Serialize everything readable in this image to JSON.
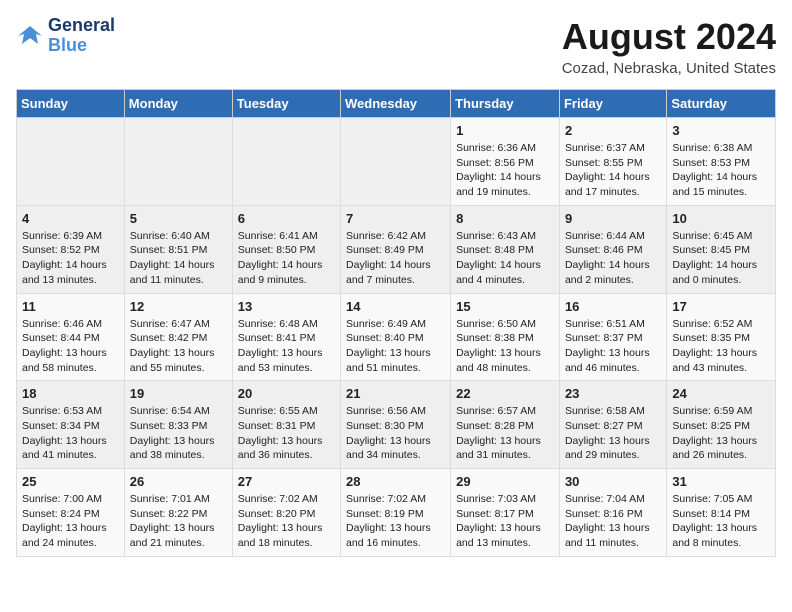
{
  "logo": {
    "line1": "General",
    "line2": "Blue"
  },
  "title": "August 2024",
  "subtitle": "Cozad, Nebraska, United States",
  "days_of_week": [
    "Sunday",
    "Monday",
    "Tuesday",
    "Wednesday",
    "Thursday",
    "Friday",
    "Saturday"
  ],
  "weeks": [
    [
      {
        "day": "",
        "info": ""
      },
      {
        "day": "",
        "info": ""
      },
      {
        "day": "",
        "info": ""
      },
      {
        "day": "",
        "info": ""
      },
      {
        "day": "1",
        "info": "Sunrise: 6:36 AM\nSunset: 8:56 PM\nDaylight: 14 hours\nand 19 minutes."
      },
      {
        "day": "2",
        "info": "Sunrise: 6:37 AM\nSunset: 8:55 PM\nDaylight: 14 hours\nand 17 minutes."
      },
      {
        "day": "3",
        "info": "Sunrise: 6:38 AM\nSunset: 8:53 PM\nDaylight: 14 hours\nand 15 minutes."
      }
    ],
    [
      {
        "day": "4",
        "info": "Sunrise: 6:39 AM\nSunset: 8:52 PM\nDaylight: 14 hours\nand 13 minutes."
      },
      {
        "day": "5",
        "info": "Sunrise: 6:40 AM\nSunset: 8:51 PM\nDaylight: 14 hours\nand 11 minutes."
      },
      {
        "day": "6",
        "info": "Sunrise: 6:41 AM\nSunset: 8:50 PM\nDaylight: 14 hours\nand 9 minutes."
      },
      {
        "day": "7",
        "info": "Sunrise: 6:42 AM\nSunset: 8:49 PM\nDaylight: 14 hours\nand 7 minutes."
      },
      {
        "day": "8",
        "info": "Sunrise: 6:43 AM\nSunset: 8:48 PM\nDaylight: 14 hours\nand 4 minutes."
      },
      {
        "day": "9",
        "info": "Sunrise: 6:44 AM\nSunset: 8:46 PM\nDaylight: 14 hours\nand 2 minutes."
      },
      {
        "day": "10",
        "info": "Sunrise: 6:45 AM\nSunset: 8:45 PM\nDaylight: 14 hours\nand 0 minutes."
      }
    ],
    [
      {
        "day": "11",
        "info": "Sunrise: 6:46 AM\nSunset: 8:44 PM\nDaylight: 13 hours\nand 58 minutes."
      },
      {
        "day": "12",
        "info": "Sunrise: 6:47 AM\nSunset: 8:42 PM\nDaylight: 13 hours\nand 55 minutes."
      },
      {
        "day": "13",
        "info": "Sunrise: 6:48 AM\nSunset: 8:41 PM\nDaylight: 13 hours\nand 53 minutes."
      },
      {
        "day": "14",
        "info": "Sunrise: 6:49 AM\nSunset: 8:40 PM\nDaylight: 13 hours\nand 51 minutes."
      },
      {
        "day": "15",
        "info": "Sunrise: 6:50 AM\nSunset: 8:38 PM\nDaylight: 13 hours\nand 48 minutes."
      },
      {
        "day": "16",
        "info": "Sunrise: 6:51 AM\nSunset: 8:37 PM\nDaylight: 13 hours\nand 46 minutes."
      },
      {
        "day": "17",
        "info": "Sunrise: 6:52 AM\nSunset: 8:35 PM\nDaylight: 13 hours\nand 43 minutes."
      }
    ],
    [
      {
        "day": "18",
        "info": "Sunrise: 6:53 AM\nSunset: 8:34 PM\nDaylight: 13 hours\nand 41 minutes."
      },
      {
        "day": "19",
        "info": "Sunrise: 6:54 AM\nSunset: 8:33 PM\nDaylight: 13 hours\nand 38 minutes."
      },
      {
        "day": "20",
        "info": "Sunrise: 6:55 AM\nSunset: 8:31 PM\nDaylight: 13 hours\nand 36 minutes."
      },
      {
        "day": "21",
        "info": "Sunrise: 6:56 AM\nSunset: 8:30 PM\nDaylight: 13 hours\nand 34 minutes."
      },
      {
        "day": "22",
        "info": "Sunrise: 6:57 AM\nSunset: 8:28 PM\nDaylight: 13 hours\nand 31 minutes."
      },
      {
        "day": "23",
        "info": "Sunrise: 6:58 AM\nSunset: 8:27 PM\nDaylight: 13 hours\nand 29 minutes."
      },
      {
        "day": "24",
        "info": "Sunrise: 6:59 AM\nSunset: 8:25 PM\nDaylight: 13 hours\nand 26 minutes."
      }
    ],
    [
      {
        "day": "25",
        "info": "Sunrise: 7:00 AM\nSunset: 8:24 PM\nDaylight: 13 hours\nand 24 minutes."
      },
      {
        "day": "26",
        "info": "Sunrise: 7:01 AM\nSunset: 8:22 PM\nDaylight: 13 hours\nand 21 minutes."
      },
      {
        "day": "27",
        "info": "Sunrise: 7:02 AM\nSunset: 8:20 PM\nDaylight: 13 hours\nand 18 minutes."
      },
      {
        "day": "28",
        "info": "Sunrise: 7:02 AM\nSunset: 8:19 PM\nDaylight: 13 hours\nand 16 minutes."
      },
      {
        "day": "29",
        "info": "Sunrise: 7:03 AM\nSunset: 8:17 PM\nDaylight: 13 hours\nand 13 minutes."
      },
      {
        "day": "30",
        "info": "Sunrise: 7:04 AM\nSunset: 8:16 PM\nDaylight: 13 hours\nand 11 minutes."
      },
      {
        "day": "31",
        "info": "Sunrise: 7:05 AM\nSunset: 8:14 PM\nDaylight: 13 hours\nand 8 minutes."
      }
    ]
  ]
}
